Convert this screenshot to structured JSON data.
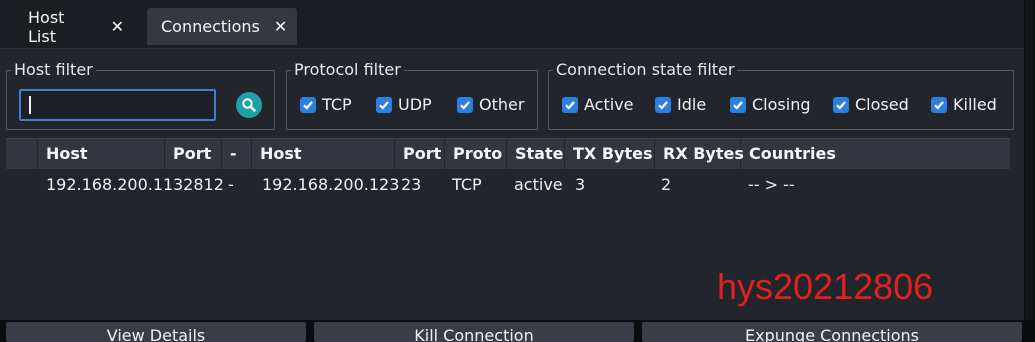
{
  "tabs": [
    {
      "label": "Host List",
      "close": "✕"
    },
    {
      "label": "Connections",
      "close": "✕"
    }
  ],
  "filters": {
    "host": {
      "title": "Host filter",
      "value": ""
    },
    "protocol": {
      "title": "Protocol filter",
      "options": [
        {
          "label": "TCP",
          "checked": true
        },
        {
          "label": "UDP",
          "checked": true
        },
        {
          "label": "Other",
          "checked": true
        }
      ]
    },
    "state": {
      "title": "Connection state filter",
      "options": [
        {
          "label": "Active",
          "checked": true
        },
        {
          "label": "Idle",
          "checked": true
        },
        {
          "label": "Closing",
          "checked": true
        },
        {
          "label": "Closed",
          "checked": true
        },
        {
          "label": "Killed",
          "checked": true
        }
      ]
    }
  },
  "table": {
    "columns": [
      "Host",
      "Port",
      "-",
      "Host",
      "Port",
      "Proto",
      "State",
      "TX Bytes",
      "RX Bytes",
      "Countries"
    ],
    "rows": [
      [
        "192.168.200.11",
        "32812",
        "-",
        "192.168.200.123",
        "23",
        "TCP",
        "active",
        "3",
        "2",
        "-- > --"
      ]
    ]
  },
  "watermark": "hys20212806",
  "buttons": [
    "View Details",
    "Kill Connection",
    "Expunge Connections"
  ],
  "icons": {
    "search": "search-icon",
    "checkbox": "check-icon",
    "close": "close-icon"
  },
  "colors": {
    "accent": "#2b7fe0",
    "search": "#1ea0a8",
    "watermark": "#e0211e"
  }
}
